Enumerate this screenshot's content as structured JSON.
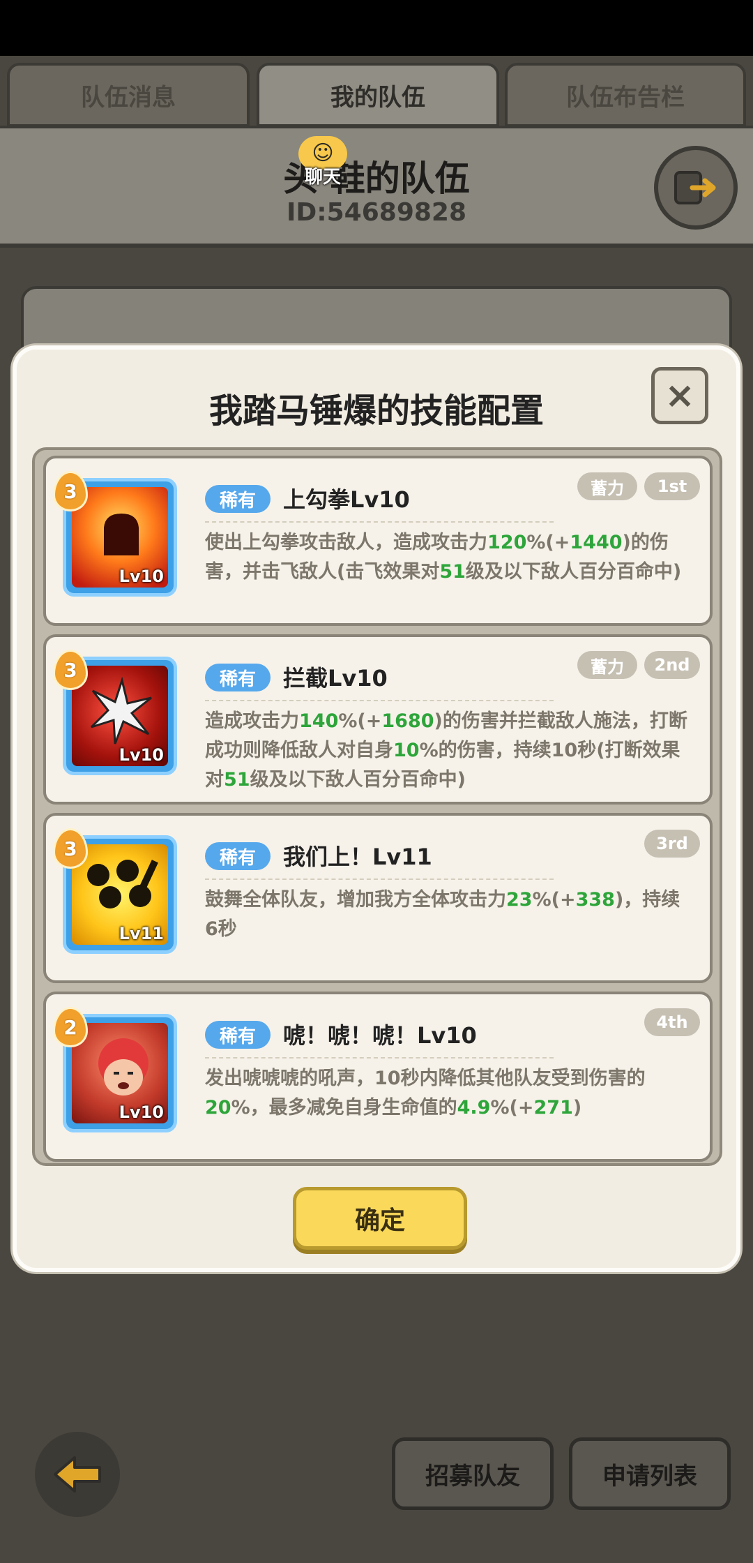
{
  "tabs": [
    "队伍消息",
    "我的队伍",
    "队伍布告栏"
  ],
  "header": {
    "team_name": "头       鞋的队伍",
    "team_id": "ID:54689828",
    "chat_label": "聊天"
  },
  "modal": {
    "title": "我踏马锤爆的技能配置",
    "close_label": "×",
    "confirm_label": "确定",
    "skills": [
      {
        "badge": "3",
        "rarity": "稀有",
        "name": "上勾拳Lv10",
        "icon_level": "Lv10",
        "type_tag": "蓄力",
        "order_tag": "1st",
        "desc_parts": [
          "使出上勾拳攻击敌人，造成攻击力",
          "120",
          "%(+",
          "1440",
          ")的伤害，并击飞敌人(击飞效果对",
          "51",
          "级及以下敌人百分百命中)"
        ]
      },
      {
        "badge": "3",
        "rarity": "稀有",
        "name": "拦截Lv10",
        "icon_level": "Lv10",
        "type_tag": "蓄力",
        "order_tag": "2nd",
        "desc_parts": [
          "造成攻击力",
          "140",
          "%(+",
          "1680",
          ")的伤害并拦截敌人施法，打断成功则降低敌人对自身",
          "10",
          "%的伤害，持续10秒(打断效果对",
          "51",
          "级及以下敌人百分百命中)"
        ]
      },
      {
        "badge": "3",
        "rarity": "稀有",
        "name": "我们上！Lv11",
        "icon_level": "Lv11",
        "type_tag": "",
        "order_tag": "3rd",
        "desc_parts": [
          "鼓舞全体队友，增加我方全体攻击力",
          "23",
          "%(+",
          "338",
          ")，持续6秒"
        ]
      },
      {
        "badge": "2",
        "rarity": "稀有",
        "name": "唬！唬！唬！Lv10",
        "icon_level": "Lv10",
        "type_tag": "",
        "order_tag": "4th",
        "desc_parts": [
          "发出唬唬唬的吼声，10秒内降低其他队友受到伤害的",
          "20",
          "%，最多减免自身生命值的",
          "4.9",
          "%(+",
          "271",
          ")"
        ]
      }
    ]
  },
  "bottom": {
    "recruit_label": "招募队友",
    "apply_label": "申请列表"
  },
  "colors": {
    "highlight": "#2ea53a",
    "rarity": "#56a8ec",
    "confirm": "#f9d85a"
  }
}
